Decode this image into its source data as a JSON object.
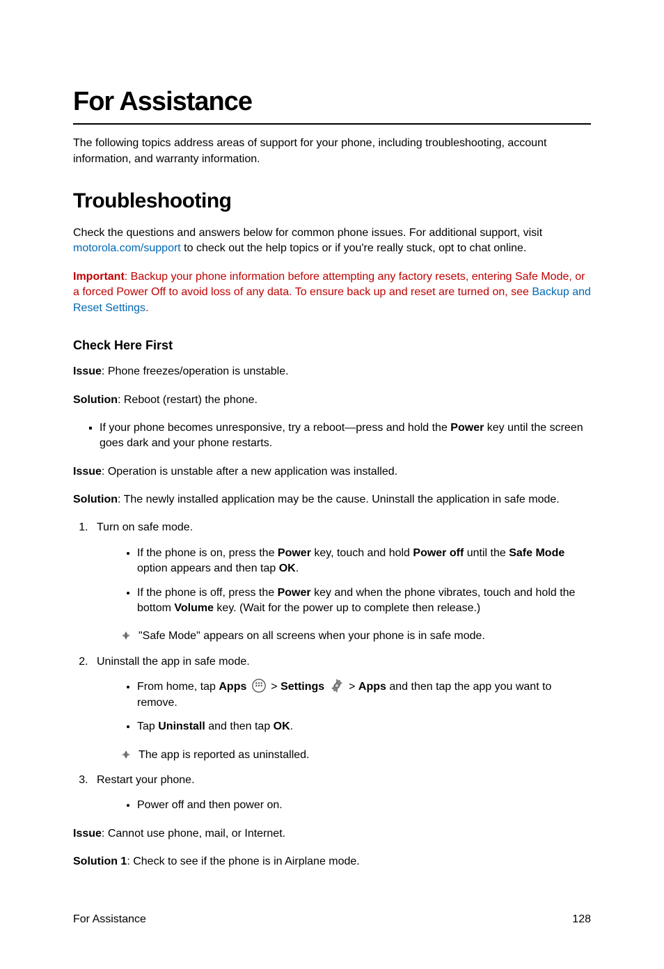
{
  "page": {
    "title": "For Assistance",
    "intro": "The following topics address areas of support for your phone, including troubleshooting, account information, and warranty information.",
    "footer_left": "For Assistance",
    "footer_right": "128"
  },
  "troubleshooting": {
    "heading": "Troubleshooting",
    "intro_part1": "Check the questions and answers below for common phone issues. For additional support, visit ",
    "intro_link": "motorola.com/support",
    "intro_part2": " to check out the help topics or if you're really stuck, opt to chat online.",
    "important_label": "Important",
    "important_text": ": Backup your phone information before attempting any factory resets, entering Safe Mode, or a forced Power Off to avoid loss of any data. To ensure back up and reset are turned on, see ",
    "important_link": "Backup and Reset Settings",
    "important_period": "."
  },
  "check_first": {
    "heading": "Check Here First",
    "issue1_label": "Issue",
    "issue1_text": ": Phone freezes/operation is unstable.",
    "solution1_label": "Solution",
    "solution1_text": ": Reboot (restart) the phone.",
    "bullet1_part1": "If your phone becomes unresponsive, try a reboot—press and hold the ",
    "bullet1_bold": "Power",
    "bullet1_part2": " key until the screen goes dark and your phone restarts.",
    "issue2_label": "Issue",
    "issue2_text": ": Operation is unstable after a new application was installed.",
    "solution2_label": "Solution",
    "solution2_text": ": The newly installed application may be the cause. Uninstall the application in safe mode.",
    "step1": "Turn on safe mode.",
    "step1_b1_p1": "If the phone is on, press the ",
    "step1_b1_bold1": "Power",
    "step1_b1_p2": " key, touch and hold ",
    "step1_b1_bold2": "Power off",
    "step1_b1_p3": " until the ",
    "step1_b1_bold3": "Safe Mode",
    "step1_b1_p4": " option appears and then tap ",
    "step1_b1_bold4": "OK",
    "step1_b1_p5": ".",
    "step1_b2_p1": "If the phone is off, press the ",
    "step1_b2_bold1": "Power",
    "step1_b2_p2": " key and when the phone vibrates, touch and hold the bottom ",
    "step1_b2_bold2": "Volume",
    "step1_b2_p3": " key. (Wait for the power up to complete then release.)",
    "note1": "\"Safe Mode\" appears on all screens when your phone is in safe mode.",
    "step2": "Uninstall the app in safe mode.",
    "step2_b1_p1": "From home, tap ",
    "step2_b1_bold1": "Apps",
    "step2_b1_gt1": " > ",
    "step2_b1_bold2": "Settings",
    "step2_b1_gt2": " > ",
    "step2_b1_bold3": "Apps",
    "step2_b1_p2": " and then tap the app you want to remove.",
    "step2_b2_p1": "Tap ",
    "step2_b2_bold1": "Uninstall",
    "step2_b2_p2": " and then tap ",
    "step2_b2_bold2": "OK",
    "step2_b2_p3": ".",
    "note2": "The app is reported as uninstalled.",
    "step3": "Restart your phone.",
    "step3_b1": "Power off and then power on.",
    "issue3_label": "Issue",
    "issue3_text": ": Cannot use phone, mail, or Internet.",
    "solution3_label": "Solution 1",
    "solution3_text": ": Check to see if the phone is in Airplane mode."
  }
}
